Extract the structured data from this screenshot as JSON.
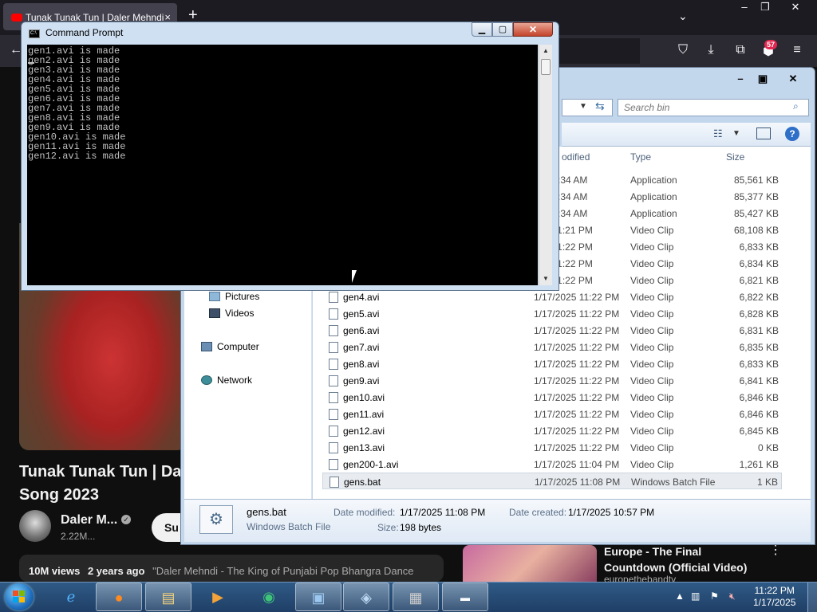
{
  "firefox": {
    "tab_title": "Tunak Tunak Tun | Daler Mehndi",
    "tab_close": "×",
    "new_tab": "+",
    "list_all_tabs": "⌄",
    "window_minimize": "–",
    "window_restore": "❐",
    "window_close": "✕",
    "notifications_badge": "57",
    "back": "←"
  },
  "youtube": {
    "title_line1": "Tunak Tunak Tun | Dal",
    "title_line2": "Song 2023",
    "channel": "Daler M...",
    "verified": "✓",
    "subscribers": "2.22M...",
    "subscribe": "Su",
    "views": "10M views",
    "age": "2 years ago",
    "description": "\"Daler Mehndi - The King of Punjabi Pop Bhangra Dance",
    "rec_title": "Europe - The Final Countdown (Official Video)",
    "rec_channel": "europethebandtv",
    "rec_menu": "⋮"
  },
  "explorer": {
    "search_placeholder": "Search bin",
    "columns": {
      "modified": "odified",
      "type": "Type",
      "size": "Size"
    },
    "nav": [
      {
        "label": "Pictures"
      },
      {
        "label": "Videos"
      },
      {
        "label": "Computer"
      },
      {
        "label": "Network"
      }
    ],
    "rows": [
      {
        "name": "",
        "date": "025 5:34 AM",
        "type": "Application",
        "size": "85,561 KB"
      },
      {
        "name": "",
        "date": "025 5:34 AM",
        "type": "Application",
        "size": "85,377 KB"
      },
      {
        "name": "",
        "date": "025 5:34 AM",
        "type": "Application",
        "size": "85,427 KB"
      },
      {
        "name": "",
        "date": "025 11:21 PM",
        "type": "Video Clip",
        "size": "68,108 KB"
      },
      {
        "name": "",
        "date": "025 11:22 PM",
        "type": "Video Clip",
        "size": "6,833 KB"
      },
      {
        "name": "",
        "date": "025 11:22 PM",
        "type": "Video Clip",
        "size": "6,834 KB"
      },
      {
        "name": "",
        "date": "025 11:22 PM",
        "type": "Video Clip",
        "size": "6,821 KB"
      },
      {
        "name": "gen4.avi",
        "date": "1/17/2025 11:22 PM",
        "type": "Video Clip",
        "size": "6,822 KB"
      },
      {
        "name": "gen5.avi",
        "date": "1/17/2025 11:22 PM",
        "type": "Video Clip",
        "size": "6,828 KB"
      },
      {
        "name": "gen6.avi",
        "date": "1/17/2025 11:22 PM",
        "type": "Video Clip",
        "size": "6,831 KB"
      },
      {
        "name": "gen7.avi",
        "date": "1/17/2025 11:22 PM",
        "type": "Video Clip",
        "size": "6,835 KB"
      },
      {
        "name": "gen8.avi",
        "date": "1/17/2025 11:22 PM",
        "type": "Video Clip",
        "size": "6,833 KB"
      },
      {
        "name": "gen9.avi",
        "date": "1/17/2025 11:22 PM",
        "type": "Video Clip",
        "size": "6,841 KB"
      },
      {
        "name": "gen10.avi",
        "date": "1/17/2025 11:22 PM",
        "type": "Video Clip",
        "size": "6,846 KB"
      },
      {
        "name": "gen11.avi",
        "date": "1/17/2025 11:22 PM",
        "type": "Video Clip",
        "size": "6,846 KB"
      },
      {
        "name": "gen12.avi",
        "date": "1/17/2025 11:22 PM",
        "type": "Video Clip",
        "size": "6,845 KB"
      },
      {
        "name": "gen13.avi",
        "date": "1/17/2025 11:22 PM",
        "type": "Video Clip",
        "size": "0 KB"
      },
      {
        "name": "gen200-1.avi",
        "date": "1/17/2025 11:04 PM",
        "type": "Video Clip",
        "size": "1,261 KB"
      },
      {
        "name": "gens.bat",
        "date": "1/17/2025 11:08 PM",
        "type": "Windows Batch File",
        "size": "1 KB",
        "selected": true
      }
    ],
    "details": {
      "file_name": "gens.bat",
      "file_type": "Windows Batch File",
      "modified_label": "Date modified:",
      "modified_value": "1/17/2025 11:08 PM",
      "created_label": "Date created:",
      "created_value": "1/17/2025 10:57 PM",
      "size_label": "Size:",
      "size_value": "198 bytes"
    }
  },
  "cmd": {
    "title": "Command Prompt",
    "icon_text": "C:\\",
    "lines": [
      "gen1.avi is made",
      "gen2.avi is made",
      "gen3.avi is made",
      "gen4.avi is made",
      "gen5.avi is made",
      "gen6.avi is made",
      "gen7.avi is made",
      "gen8.avi is made",
      "gen9.avi is made",
      "gen10.avi is made",
      "gen11.avi is made",
      "gen12.avi is made"
    ]
  },
  "taskbar": {
    "time": "11:22 PM",
    "date": "1/17/2025"
  }
}
